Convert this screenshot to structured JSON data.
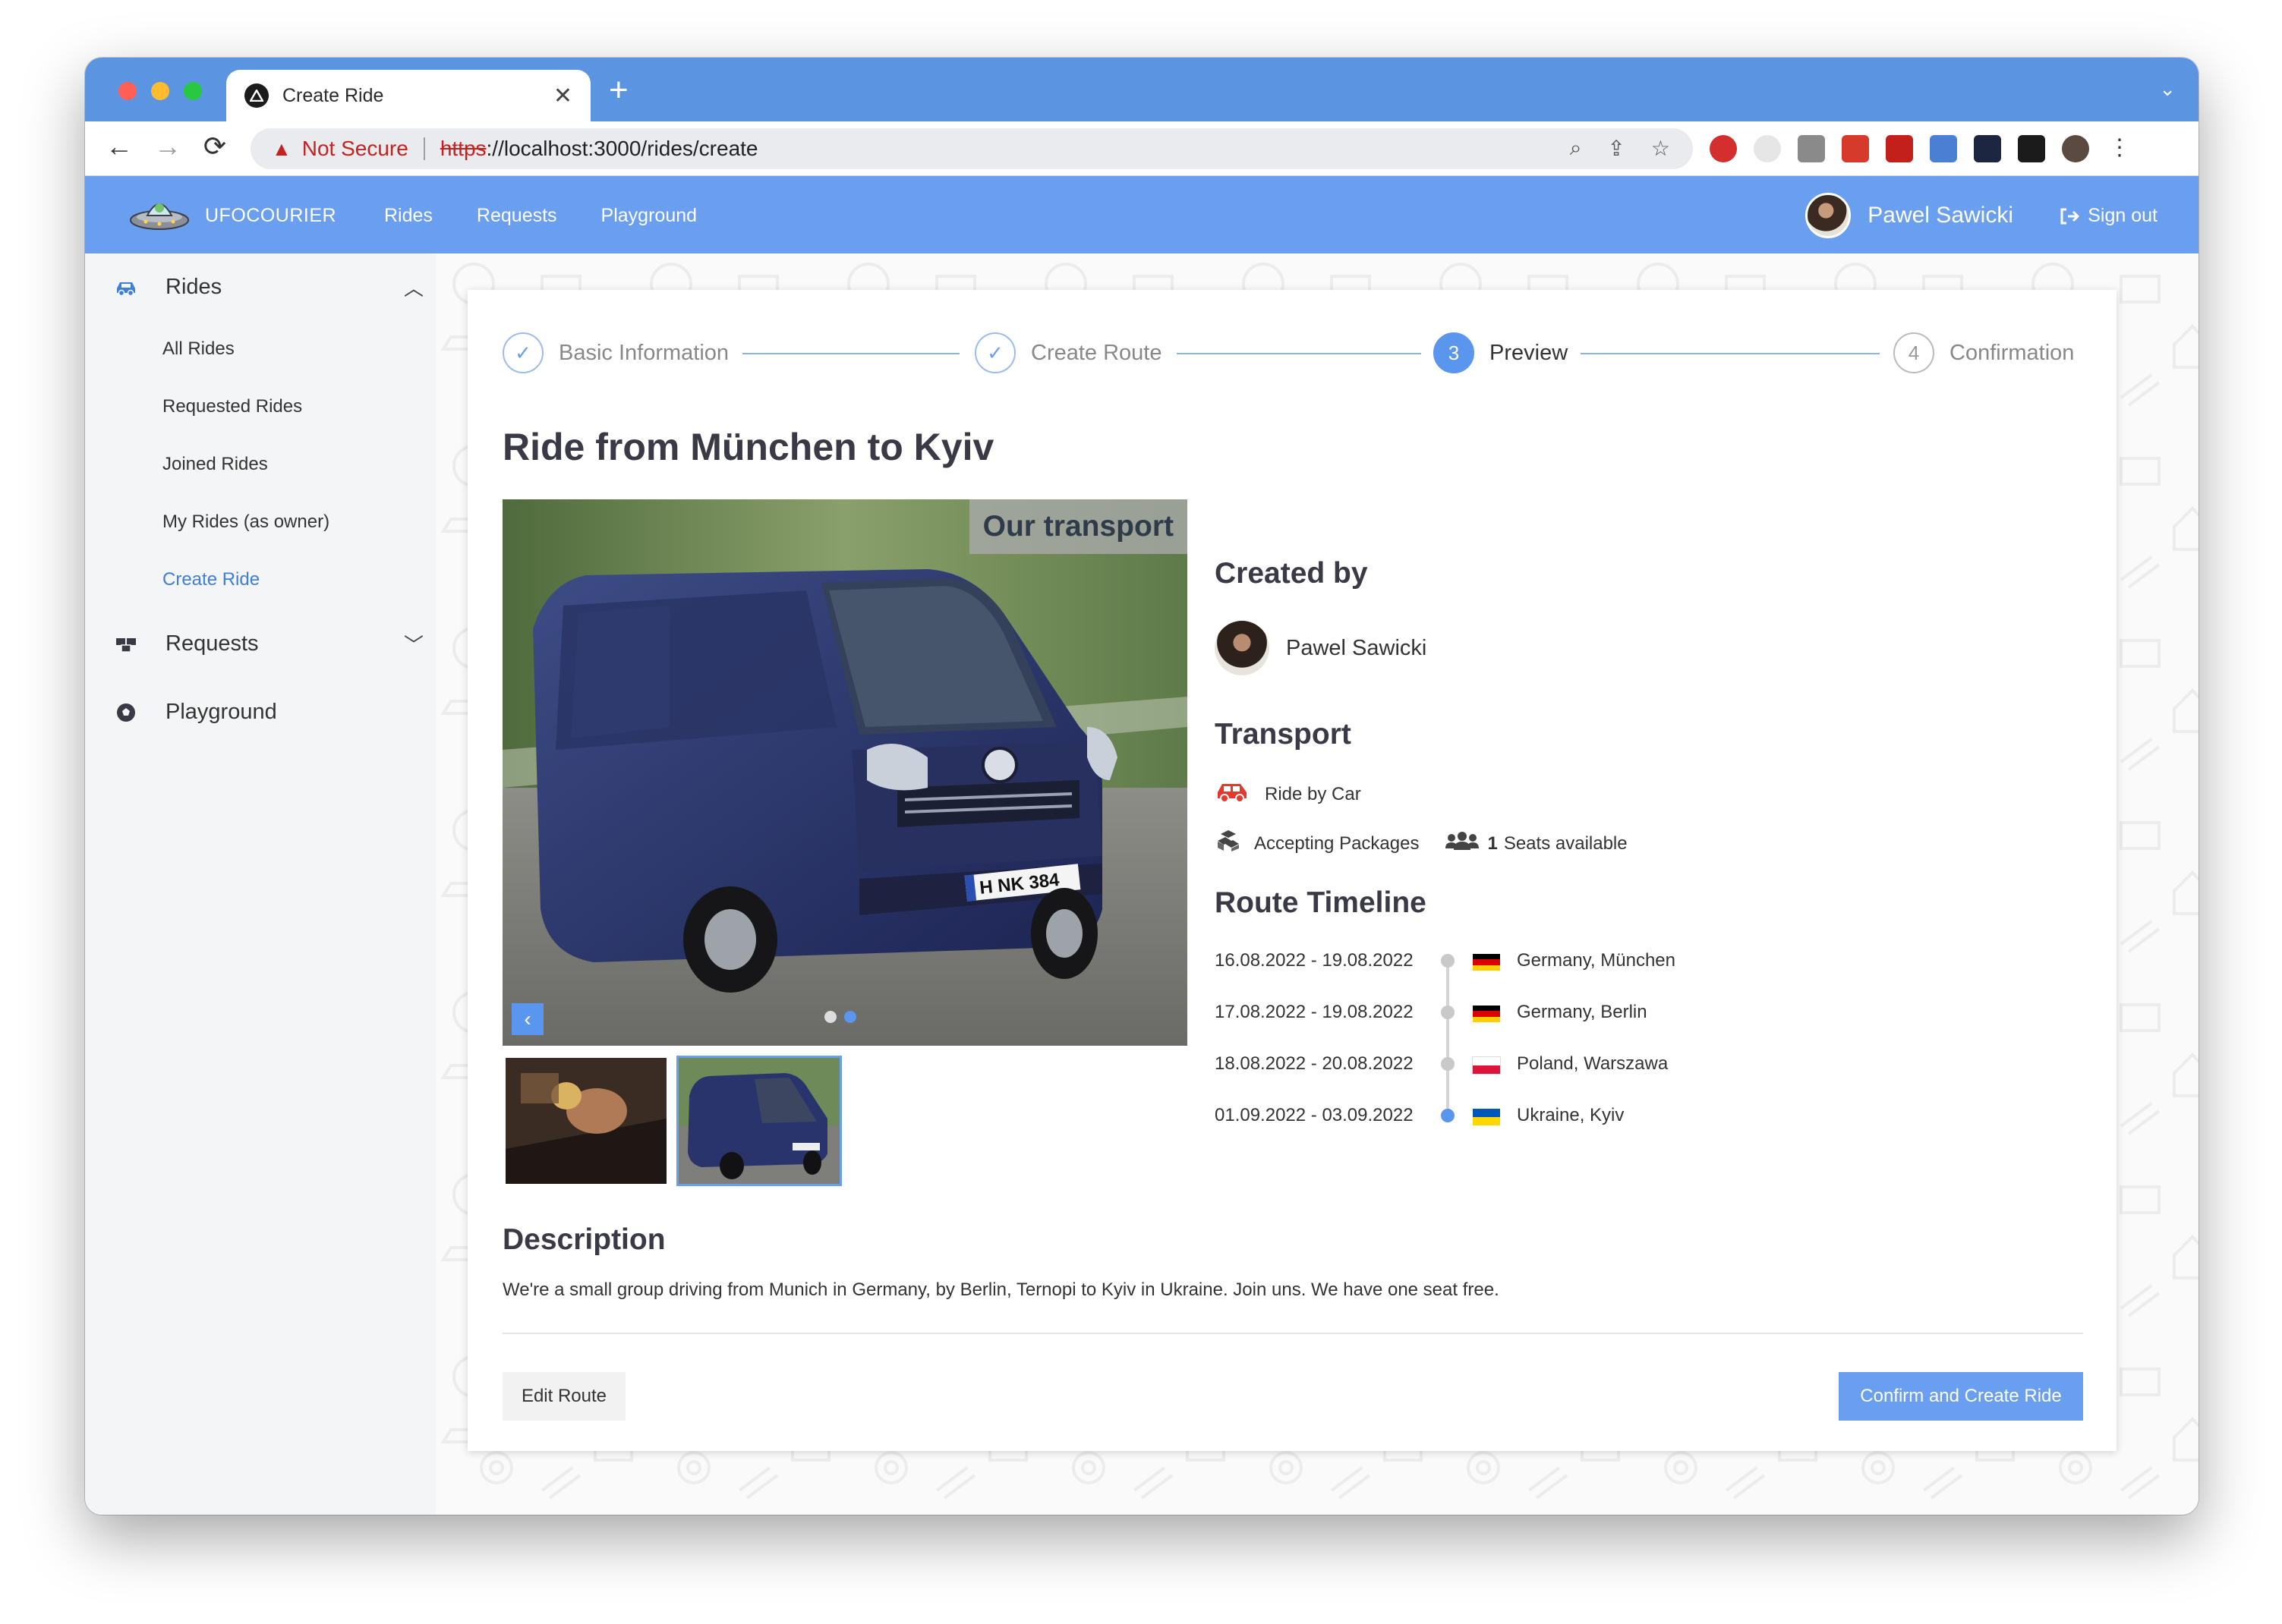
{
  "browser": {
    "tab_title": "Create Ride",
    "url_warning": "Not Secure",
    "url_protocol": "https",
    "url_rest": "://localhost:3000/rides/create"
  },
  "appbar": {
    "brand": "UFOCOURIER",
    "nav": [
      "Rides",
      "Requests",
      "Playground"
    ],
    "user_name": "Pawel Sawicki",
    "signout": "Sign out"
  },
  "sidebar": {
    "rides": "Rides",
    "items": [
      "All Rides",
      "Requested Rides",
      "Joined Rides",
      "My Rides (as owner)",
      "Create Ride"
    ],
    "requests": "Requests",
    "playground": "Playground"
  },
  "stepper": [
    {
      "label": "Basic Information",
      "state": "done"
    },
    {
      "label": "Create Route",
      "state": "done"
    },
    {
      "label": "Preview",
      "number": "3",
      "state": "active"
    },
    {
      "label": "Confirmation",
      "number": "4",
      "state": "todo"
    }
  ],
  "ride_title": "Ride from München to Kyiv",
  "gallery": {
    "tag": "Our transport",
    "plate": "H NK 384",
    "slide_count": 2,
    "active_slide": 2
  },
  "created_by": {
    "heading": "Created by",
    "name": "Pawel Sawicki"
  },
  "transport": {
    "heading": "Transport",
    "ride_type": "Ride by Car",
    "packages": "Accepting Packages",
    "seats_count": "1",
    "seats_label": "Seats available"
  },
  "timeline": {
    "heading": "Route Timeline",
    "stops": [
      {
        "dates": "16.08.2022 - 19.08.2022",
        "place": "Germany, München",
        "flag": [
          "#000000",
          "#dd0000",
          "#ffce00"
        ]
      },
      {
        "dates": "17.08.2022 - 19.08.2022",
        "place": "Germany, Berlin",
        "flag": [
          "#000000",
          "#dd0000",
          "#ffce00"
        ]
      },
      {
        "dates": "18.08.2022 - 20.08.2022",
        "place": "Poland, Warszawa",
        "flag": [
          "#ffffff",
          "#dc143c"
        ]
      },
      {
        "dates": "01.09.2022 - 03.09.2022",
        "place": "Ukraine, Kyiv",
        "flag": [
          "#0057b7",
          "#ffd700"
        ]
      }
    ]
  },
  "description": {
    "heading": "Description",
    "text": "We're a small group driving from Munich in Germany, by Berlin, Ternopi to Kyiv in Ukraine. Join uns. We have one seat free."
  },
  "actions": {
    "edit": "Edit Route",
    "confirm": "Confirm and Create Ride"
  },
  "colors": {
    "accent": "#6a9ff0",
    "tabstrip": "#5b95e2",
    "car_icon": "#e23b2e"
  }
}
